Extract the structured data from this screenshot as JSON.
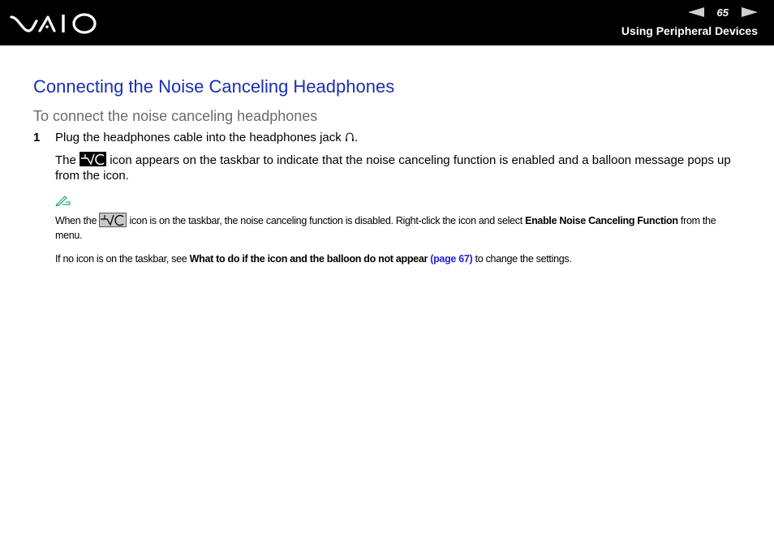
{
  "header": {
    "logo": "VAIO",
    "page_number": "65",
    "section_title": "Using Peripheral Devices",
    "prev_icon": "triangle-left-icon",
    "next_icon": "triangle-right-icon"
  },
  "content": {
    "title": "Connecting the Noise Canceling Headphones",
    "subtitle": "To connect the noise canceling headphones",
    "step": {
      "number": "1",
      "text": "Plug the headphones cable into the headphones jack",
      "icon": "headphones-icon",
      "end": "."
    },
    "paragraph": {
      "before_icon": "The",
      "icon": "noise-canceling-enabled-icon",
      "after_icon": "icon appears on the taskbar to indicate that the noise canceling function is enabled and a balloon message pops up from the icon."
    },
    "note": {
      "icon": "note-pencil-icon",
      "line1_before": "When the",
      "line1_icon": "noise-canceling-disabled-icon",
      "line1_after": "icon is on the taskbar, the noise canceling function is disabled. Right-click the icon and select",
      "line1_bold": "Enable Noise Canceling Function",
      "line1_end": "from the menu.",
      "line2_before": "If no icon is on the taskbar, see",
      "line2_bold": "What to do if the icon and the balloon do not appear",
      "line2_link": "(page 67)",
      "line2_end": "to change the settings."
    }
  },
  "colors": {
    "title": "#1a2fb0",
    "subtitle": "#6a6a6a",
    "link": "#2222dd",
    "note_icon": "#2aa876"
  }
}
